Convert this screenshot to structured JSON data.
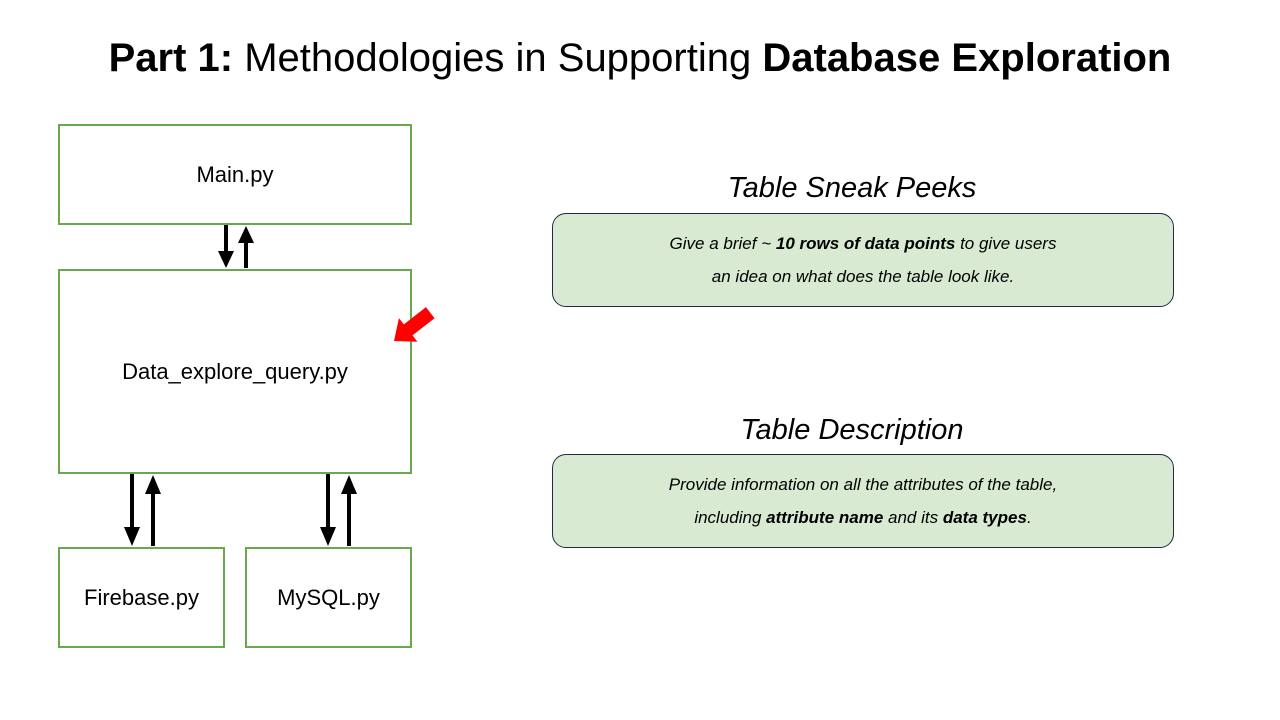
{
  "title": {
    "prefix": "Part 1:",
    "middle": " Methodologies in Supporting ",
    "emphasis": "Database Exploration"
  },
  "diagram": {
    "main": "Main.py",
    "query": "Data_explore_query.py",
    "firebase": "Firebase.py",
    "mysql": "MySQL.py",
    "box_border_color": "#6aa84f",
    "pointer_color": "#ff0000"
  },
  "panels": {
    "peeks": {
      "title": "Table Sneak Peeks",
      "line1_before": "Give a brief ~ ",
      "line1_bold": "10 rows of data points",
      "line1_after": " to give users",
      "line2": "an idea on what does the table look like."
    },
    "description": {
      "title": "Table Description",
      "line1": "Provide information on all the attributes of the table,",
      "line2_before": "including ",
      "line2_bold1": "attribute name",
      "line2_mid": " and its ",
      "line2_bold2": "data types",
      "line2_after": "."
    },
    "fill_color": "#d9ead3"
  }
}
